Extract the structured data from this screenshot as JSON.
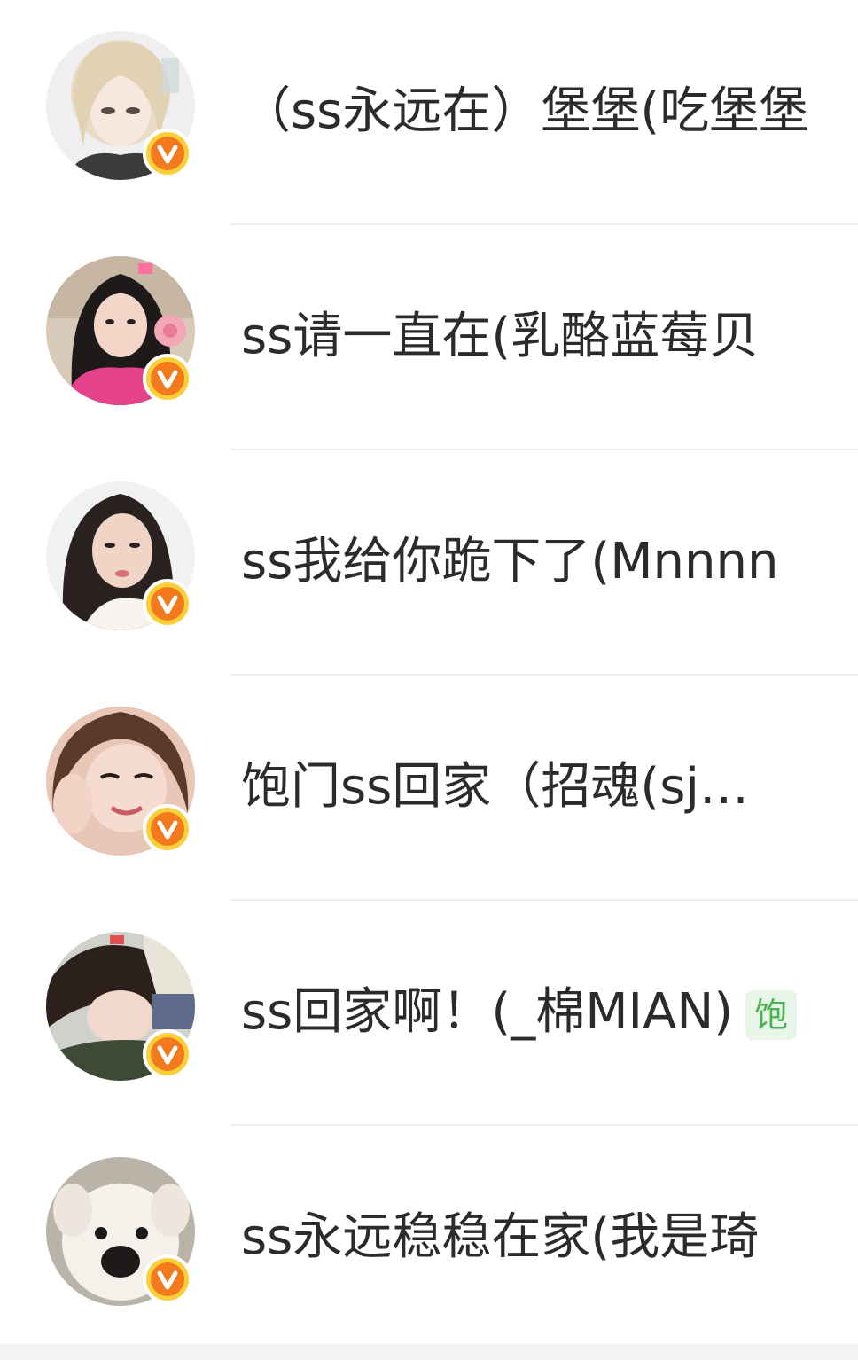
{
  "members": [
    {
      "name": "（ss永远在）堡堡(吃堡堡",
      "avatar_icon": "anime-girl-avatar-icon",
      "badge_icon": "verified-v-icon"
    },
    {
      "name": "ss请一直在(乳酪蓝莓贝",
      "avatar_icon": "girl-pink-top-avatar-icon",
      "badge_icon": "verified-v-icon"
    },
    {
      "name": "ss我给你跪下了(Mnnnn",
      "avatar_icon": "girl-portrait-avatar-icon",
      "badge_icon": "verified-v-icon"
    },
    {
      "name": "饱门ss回家（招魂(sj…",
      "avatar_icon": "smiling-girl-avatar-icon",
      "badge_icon": "verified-v-icon"
    },
    {
      "name": "ss回家啊！(_棉MIAN)",
      "tag": "饱",
      "avatar_icon": "sleeping-girl-avatar-icon",
      "badge_icon": "verified-v-icon"
    },
    {
      "name": "ss永远稳稳在家(我是琦",
      "avatar_icon": "white-dog-avatar-icon",
      "badge_icon": "verified-v-icon"
    }
  ],
  "colors": {
    "badge_outer": "#fbcf3a",
    "badge_inner": "#f27a1c",
    "text": "#2b2b2b",
    "divider": "#ececec",
    "tag_text": "#4caf50",
    "tag_bg": "#e7f6e9"
  }
}
